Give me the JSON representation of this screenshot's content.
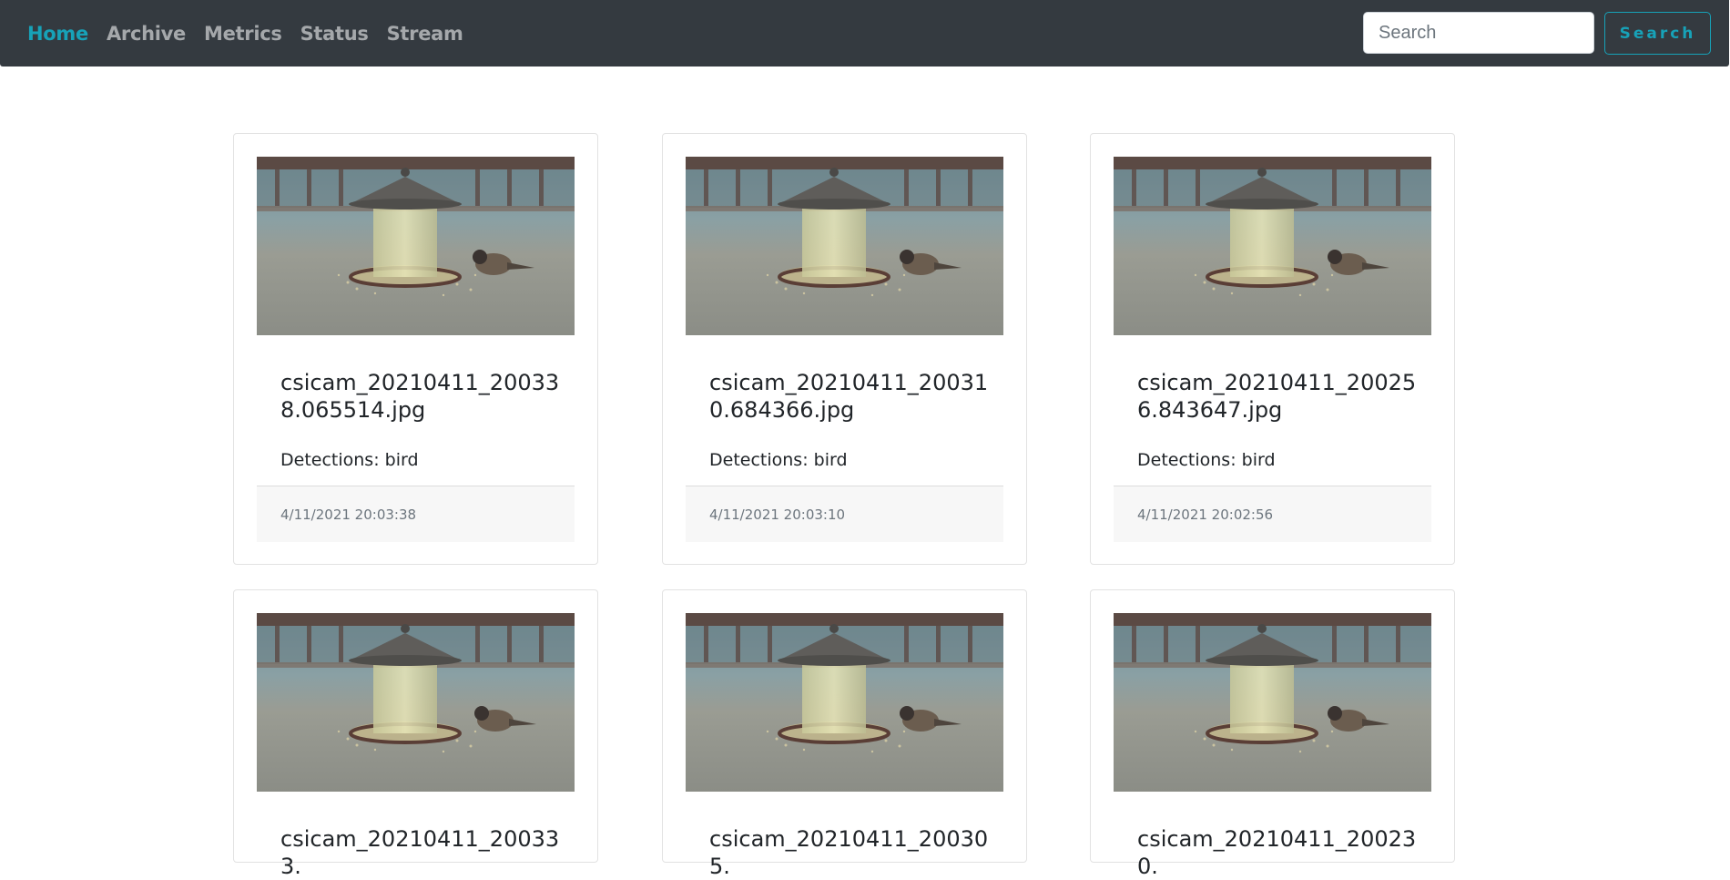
{
  "nav": {
    "items": [
      {
        "label": "Home",
        "active": true
      },
      {
        "label": "Archive",
        "active": false
      },
      {
        "label": "Metrics",
        "active": false
      },
      {
        "label": "Status",
        "active": false
      },
      {
        "label": "Stream",
        "active": false
      }
    ],
    "search_placeholder": "Search",
    "search_button": "Search"
  },
  "colors": {
    "navbar": "#343a40",
    "accent": "#17a2b8",
    "nav_inactive": "#a5a8ab"
  },
  "cards": [
    {
      "title": "csicam_20210411_200338.065514.jpg",
      "detections": "Detections: bird",
      "timestamp": "4/11/2021 20:03:38"
    },
    {
      "title": "csicam_20210411_200310.684366.jpg",
      "detections": "Detections: bird",
      "timestamp": "4/11/2021 20:03:10"
    },
    {
      "title": "csicam_20210411_200256.843647.jpg",
      "detections": "Detections: bird",
      "timestamp": "4/11/2021 20:02:56"
    },
    {
      "title": "csicam_20210411_200333.",
      "detections": "",
      "timestamp": ""
    },
    {
      "title": "csicam_20210411_200305.",
      "detections": "",
      "timestamp": ""
    },
    {
      "title": "csicam_20210411_200230.",
      "detections": "",
      "timestamp": ""
    }
  ]
}
